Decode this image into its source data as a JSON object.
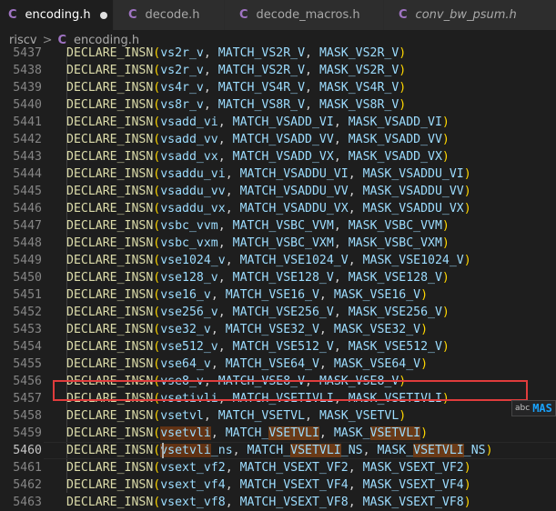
{
  "tabs": [
    {
      "label": "encoding.h",
      "modified": true,
      "active": true
    },
    {
      "label": "decode.h",
      "modified": false,
      "active": false
    },
    {
      "label": "decode_macros.h",
      "modified": false,
      "active": false
    },
    {
      "label": "conv_bw_psum.h",
      "modified": false,
      "active": false
    }
  ],
  "file_icon_glyph": "C",
  "breadcrumb": {
    "folder": "riscv",
    "separator": ">",
    "file": "encoding.h"
  },
  "colors": {
    "accent_c": "#a074c4",
    "function": "#dcdcaa",
    "paren": "#ffd700",
    "highlight": "#613214",
    "red_box": "#e03c3c"
  },
  "lines": [
    {
      "num": "5437",
      "name": "vs2r_v",
      "match": "MATCH_VS2R_V",
      "mask": "MASK_VS2R_V",
      "partial": true
    },
    {
      "num": "5438",
      "name": "vs2r_v",
      "match": "MATCH_VS2R_V",
      "mask": "MASK_VS2R_V"
    },
    {
      "num": "5439",
      "name": "vs4r_v",
      "match": "MATCH_VS4R_V",
      "mask": "MASK_VS4R_V"
    },
    {
      "num": "5440",
      "name": "vs8r_v",
      "match": "MATCH_VS8R_V",
      "mask": "MASK_VS8R_V"
    },
    {
      "num": "5441",
      "name": "vsadd_vi",
      "match": "MATCH_VSADD_VI",
      "mask": "MASK_VSADD_VI"
    },
    {
      "num": "5442",
      "name": "vsadd_vv",
      "match": "MATCH_VSADD_VV",
      "mask": "MASK_VSADD_VV"
    },
    {
      "num": "5443",
      "name": "vsadd_vx",
      "match": "MATCH_VSADD_VX",
      "mask": "MASK_VSADD_VX"
    },
    {
      "num": "5444",
      "name": "vsaddu_vi",
      "match": "MATCH_VSADDU_VI",
      "mask": "MASK_VSADDU_VI"
    },
    {
      "num": "5445",
      "name": "vsaddu_vv",
      "match": "MATCH_VSADDU_VV",
      "mask": "MASK_VSADDU_VV"
    },
    {
      "num": "5446",
      "name": "vsaddu_vx",
      "match": "MATCH_VSADDU_VX",
      "mask": "MASK_VSADDU_VX"
    },
    {
      "num": "5447",
      "name": "vsbc_vvm",
      "match": "MATCH_VSBC_VVM",
      "mask": "MASK_VSBC_VVM"
    },
    {
      "num": "5448",
      "name": "vsbc_vxm",
      "match": "MATCH_VSBC_VXM",
      "mask": "MASK_VSBC_VXM"
    },
    {
      "num": "5449",
      "name": "vse1024_v",
      "match": "MATCH_VSE1024_V",
      "mask": "MASK_VSE1024_V"
    },
    {
      "num": "5450",
      "name": "vse128_v",
      "match": "MATCH_VSE128_V",
      "mask": "MASK_VSE128_V"
    },
    {
      "num": "5451",
      "name": "vse16_v",
      "match": "MATCH_VSE16_V",
      "mask": "MASK_VSE16_V"
    },
    {
      "num": "5452",
      "name": "vse256_v",
      "match": "MATCH_VSE256_V",
      "mask": "MASK_VSE256_V"
    },
    {
      "num": "5453",
      "name": "vse32_v",
      "match": "MATCH_VSE32_V",
      "mask": "MASK_VSE32_V"
    },
    {
      "num": "5454",
      "name": "vse512_v",
      "match": "MATCH_VSE512_V",
      "mask": "MASK_VSE512_V"
    },
    {
      "num": "5455",
      "name": "vse64_v",
      "match": "MATCH_VSE64_V",
      "mask": "MASK_VSE64_V"
    },
    {
      "num": "5456",
      "name": "vse8_v",
      "match": "MATCH_VSE8_V",
      "mask": "MASK_VSE8_V"
    },
    {
      "num": "5457",
      "name": "vsetivli",
      "match": "MATCH_VSETIVLI",
      "mask": "MASK_VSETIVLI"
    },
    {
      "num": "5458",
      "name": "vsetvl",
      "match": "MATCH_VSETVL",
      "mask": "MASK_VSETVL"
    },
    {
      "num": "5459",
      "name": "vsetvli",
      "match": "MATCH_VSETVLI",
      "mask": "MASK_VSETVLI",
      "hl": "word"
    },
    {
      "num": "5460",
      "name": "vsetvli_ns",
      "match": "MATCH_VSETVLI_NS",
      "mask": "MASK_VSETVLI_NS",
      "hl": "word",
      "current": true
    },
    {
      "num": "5461",
      "name": "vsext_vf2",
      "match": "MATCH_VSEXT_VF2",
      "mask": "MASK_VSEXT_VF2"
    },
    {
      "num": "5462",
      "name": "vsext_vf4",
      "match": "MATCH_VSEXT_VF4",
      "mask": "MASK_VSEXT_VF4"
    },
    {
      "num": "5463",
      "name": "vsext_vf8",
      "match": "MATCH_VSEXT_VF8",
      "mask": "MASK_VSEXT_VF8",
      "partial": true
    }
  ],
  "macro": "DECLARE_INSN",
  "suggest": {
    "kind": "abc",
    "text": "MAS"
  }
}
